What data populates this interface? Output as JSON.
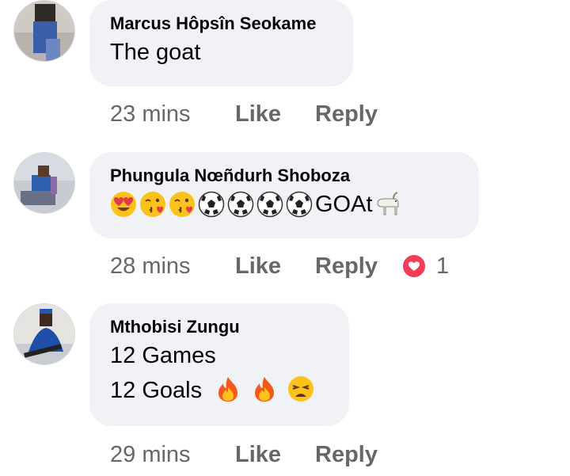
{
  "comments": [
    {
      "author": "Marcus Hôpsîn Seokame",
      "lines": [
        "The goat"
      ],
      "time": "23 mins",
      "like_label": "Like",
      "reply_label": "Reply"
    },
    {
      "author": "Phungula Nœñdurh Shoboza",
      "emoji_sequence": [
        "heart-eyes-emoji",
        "kissing-heart-emoji",
        "kissing-heart-emoji",
        "soccer-ball-emoji",
        "soccer-ball-emoji",
        "soccer-ball-emoji",
        "soccer-ball-emoji"
      ],
      "text_after_emoji": "GOAt",
      "trailing_emoji": "goat-emoji",
      "time": "28 mins",
      "like_label": "Like",
      "reply_label": "Reply",
      "reaction": {
        "icon": "love-reaction-icon",
        "count": "1"
      }
    },
    {
      "author": "Mthobisi Zungu",
      "lines": [
        "12 Games",
        "12 Goals"
      ],
      "line2_emoji": [
        "fire-emoji",
        "fire-emoji",
        "weary-face-emoji"
      ],
      "time": "29 mins",
      "like_label": "Like",
      "reply_label": "Reply"
    }
  ],
  "colors": {
    "bubble": "#f0f2f5",
    "meta_text": "#65676b",
    "love_reaction": "#f33e58"
  }
}
